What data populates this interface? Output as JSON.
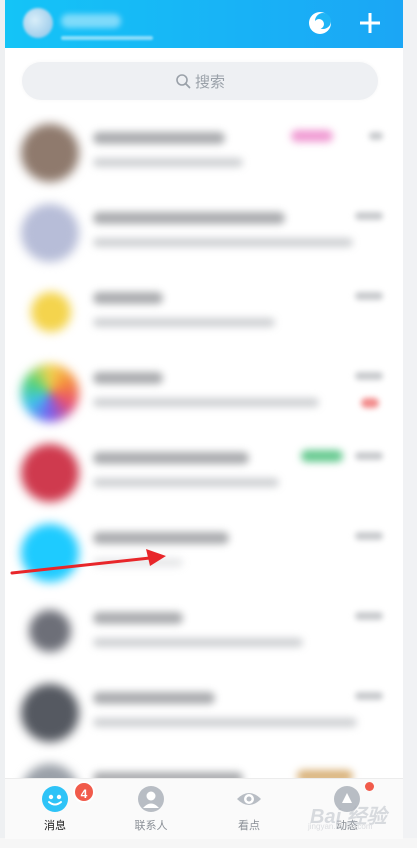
{
  "search": {
    "placeholder": "搜索"
  },
  "tabbar": {
    "tabs": [
      {
        "label": "消息",
        "badge": "4",
        "active": true
      },
      {
        "label": "联系人"
      },
      {
        "label": "看点"
      },
      {
        "label": "动态"
      }
    ]
  },
  "watermark": {
    "main": "Bai 经验",
    "sub": "jingyan.baidu.com"
  },
  "colors": {
    "header_start": "#14c4f7",
    "header_end": "#1ba6f5",
    "badge": "#f15b4b",
    "arrow": "#e8262a",
    "active_tab": "#1a1a1a"
  },
  "icons": {
    "header": [
      "moon-icon",
      "plus-icon"
    ],
    "search": "search-icon",
    "tabs": [
      "message-icon",
      "contacts-icon",
      "watch-icon",
      "feed-icon"
    ]
  },
  "conversations": [
    {
      "avatar_color": "#8f7a6d",
      "tag_color": "#f09bd3"
    },
    {
      "avatar_color": "#b7bdd8"
    },
    {
      "avatar_color": "#f4d44d"
    },
    {
      "avatar_color": "#e85d8e",
      "badge_color": "#f28a8a"
    },
    {
      "avatar_color": "#cf3a4e",
      "tag_color": "#65c98f"
    },
    {
      "avatar_color": "#1ecbff"
    },
    {
      "avatar_color": "#6d6f78"
    },
    {
      "avatar_color": "#555961"
    },
    {
      "avatar_color": "#9aa0a8",
      "tag_color": "#d9b27a"
    }
  ]
}
